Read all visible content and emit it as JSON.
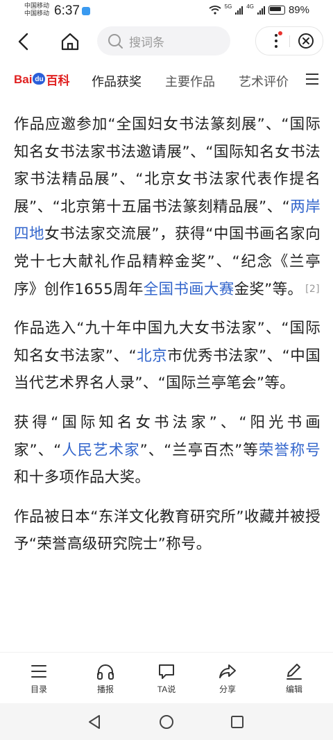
{
  "status_bar": {
    "carrier1": "中国移动",
    "carrier2": "中国移动",
    "time": "6:37",
    "net1": "5G",
    "net2": "4G",
    "battery": "89%"
  },
  "nav": {
    "search_placeholder": "搜词条"
  },
  "tabs": {
    "logo": "Bai百科",
    "items": [
      "作品获奖",
      "主要作品",
      "艺术评价"
    ]
  },
  "article": {
    "p1": {
      "a": "作品应邀参加“全国妇女书法篆刻展”、“国际知名女书法家书法邀请展”、“国际知名女书法家书法精品展”、“北京女书法家代表作提名展”、“北京第十五届书法篆刻精品展”、“",
      "link1": "两岸四地",
      "b": "女书法家交流展”，获得“中国书画名家向党十七大献礼作品精粹金奖”、“纪念《兰亭序》创作1655周年",
      "link2": "全国书画大赛",
      "c": "金奖”等。",
      "ref": "[2]"
    },
    "p2": {
      "a": "作品选入“九十年中国九大女书法家”、“国际知名女书法家”、“",
      "link1": "北京",
      "b": "市优秀书法家”、“中国当代艺术界名人录”、“国际兰亭笔会”等。"
    },
    "p3": {
      "a": "获得“国际知名女书法家”、“阳光书画家”、“",
      "link1": "人民艺术家",
      "b": "”、“兰亭百杰”等",
      "link2": "荣誉称号",
      "c": "和十多项作品大奖。"
    },
    "p4": {
      "a": "作品被日本“东洋文化教育研究所”收藏并被授予“荣誉高级研究院士”称号。"
    }
  },
  "toolbar": {
    "items": [
      "目录",
      "播报",
      "TA说",
      "分享",
      "编辑"
    ]
  },
  "colors": {
    "link": "#3366cc",
    "brand_red": "#e02020",
    "brand_blue": "#2b5fd9"
  }
}
